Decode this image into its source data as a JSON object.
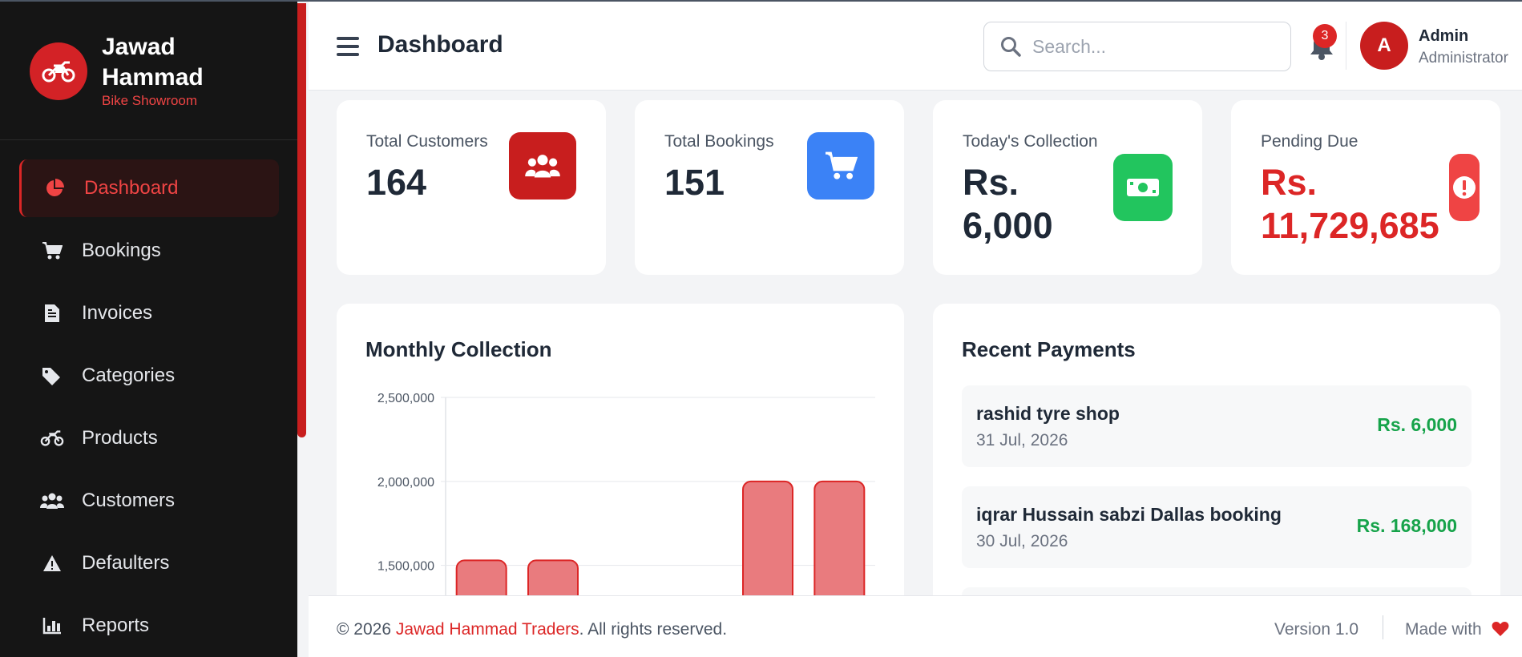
{
  "brand": {
    "name": "Jawad Hammad",
    "subtitle": "Bike Showroom"
  },
  "sidebar": {
    "items": [
      {
        "label": "Dashboard",
        "icon": "chart-pie-icon",
        "active": true
      },
      {
        "label": "Bookings",
        "icon": "cart-icon"
      },
      {
        "label": "Invoices",
        "icon": "document-icon"
      },
      {
        "label": "Categories",
        "icon": "tags-icon"
      },
      {
        "label": "Products",
        "icon": "motorcycle-icon"
      },
      {
        "label": "Customers",
        "icon": "users-icon"
      },
      {
        "label": "Defaulters",
        "icon": "warning-icon"
      },
      {
        "label": "Reports",
        "icon": "bar-chart-icon"
      }
    ]
  },
  "header": {
    "title": "Dashboard",
    "search_placeholder": "Search...",
    "notifications_count": "3",
    "user": {
      "initial": "A",
      "name": "Admin",
      "role": "Administrator"
    }
  },
  "stats": [
    {
      "label": "Total Customers",
      "value": "164",
      "icon": "users-icon",
      "color": "#c81e1e"
    },
    {
      "label": "Total Bookings",
      "value": "151",
      "icon": "cart-icon",
      "color": "#3b82f6"
    },
    {
      "label": "Today's Collection",
      "value": "Rs. 6,000",
      "icon": "money-icon",
      "color": "#22c55e"
    },
    {
      "label": "Pending Due",
      "value": "Rs. 11,729,685",
      "icon": "alert-icon",
      "color": "#ef4444"
    }
  ],
  "chart_panel": {
    "title": "Monthly Collection"
  },
  "chart_data": {
    "type": "bar",
    "title": "Monthly Collection",
    "categories": [
      "",
      "",
      "",
      "",
      "",
      ""
    ],
    "values": [
      1530000,
      1530000,
      0,
      0,
      2000000,
      2000000
    ],
    "y_ticks": [
      "2,500,000",
      "2,000,000",
      "1,500,000"
    ],
    "ylim_visible": [
      1150000,
      2500000
    ],
    "color": "#e97b7e",
    "border_color": "#dc2626",
    "grid": true
  },
  "payments_panel": {
    "title": "Recent Payments",
    "items": [
      {
        "name": "rashid tyre shop",
        "date": "31 Jul, 2026",
        "amount": "Rs. 6,000"
      },
      {
        "name": "iqrar Hussain sabzi Dallas booking",
        "date": "30 Jul, 2026",
        "amount": "Rs. 168,000"
      }
    ]
  },
  "footer": {
    "copyright_prefix": "© 2026 ",
    "company": "Jawad Hammad Traders",
    "copyright_suffix": ". All rights reserved.",
    "version": "Version 1.0",
    "made_with": "Made with"
  }
}
